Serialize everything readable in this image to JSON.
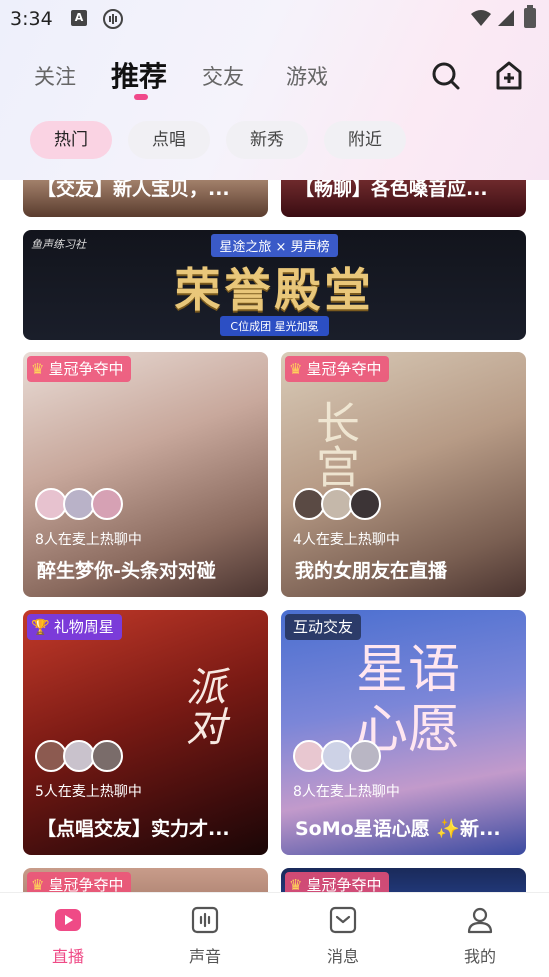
{
  "status_bar": {
    "time": "3:34",
    "icon_a": "A"
  },
  "main_tabs": [
    {
      "label": "关注"
    },
    {
      "label": "推荐"
    },
    {
      "label": "交友"
    },
    {
      "label": "游戏"
    }
  ],
  "sub_tabs": [
    {
      "label": "热门"
    },
    {
      "label": "点唱"
    },
    {
      "label": "新秀"
    },
    {
      "label": "附近"
    }
  ],
  "feed": {
    "top_cards": [
      {
        "title": "【交友】新人宝贝，..."
      },
      {
        "title": "【畅聊】各色嗓音应..."
      }
    ],
    "banner": {
      "logo": "鱼声练习社",
      "subtitle": "星途之旅 × 男声榜",
      "title": "荣誉殿堂",
      "caption": "C位成团 星光加冕"
    },
    "cards": [
      {
        "tag": "皇冠争夺中",
        "count": "8人在麦上热聊中",
        "title": "醉生梦你-头条对对碰",
        "overlay": ""
      },
      {
        "tag": "皇冠争夺中",
        "count": "4人在麦上热聊中",
        "title": "我的女朋友在直播",
        "overlay": "长宫"
      },
      {
        "tag": "礼物周星",
        "count": "5人在麦上热聊中",
        "title": "【点唱交友】实力才...",
        "overlay": "派对"
      },
      {
        "tag": "互动交友",
        "count": "8人在麦上热聊中",
        "title": "SoMo星语心愿 ✨新...",
        "overlay": "星语心愿"
      }
    ],
    "bottom_cards": [
      {
        "tag": "皇冠争夺中"
      },
      {
        "tag": "皇冠争夺中"
      }
    ]
  },
  "bottom_nav": [
    {
      "label": "直播",
      "icon": "live-play-icon"
    },
    {
      "label": "声音",
      "icon": "audio-wave-icon"
    },
    {
      "label": "消息",
      "icon": "mail-icon"
    },
    {
      "label": "我的",
      "icon": "person-icon"
    }
  ],
  "colors": {
    "accent": "#ef4a86",
    "subtab_active": "#fad3e3"
  }
}
